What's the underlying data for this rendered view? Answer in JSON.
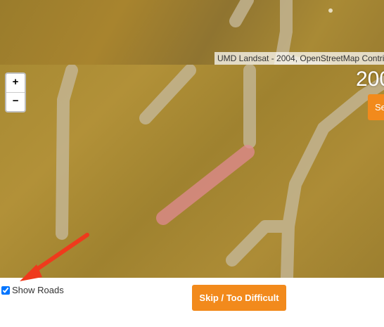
{
  "map": {
    "attribution": "UMD Landsat - 2004, OpenStreetMap Contri",
    "year": "200",
    "zoom_in": "+",
    "zoom_out": "−",
    "side_button": "Se"
  },
  "controls": {
    "show_roads_label": "Show Roads",
    "show_roads_checked": true,
    "skip_label": "Skip / Too Difficult"
  },
  "colors": {
    "accent": "#f28a1c",
    "road": "#c4b797",
    "highlight": "#e08a92",
    "annotation_arrow": "#ef3a1c"
  }
}
